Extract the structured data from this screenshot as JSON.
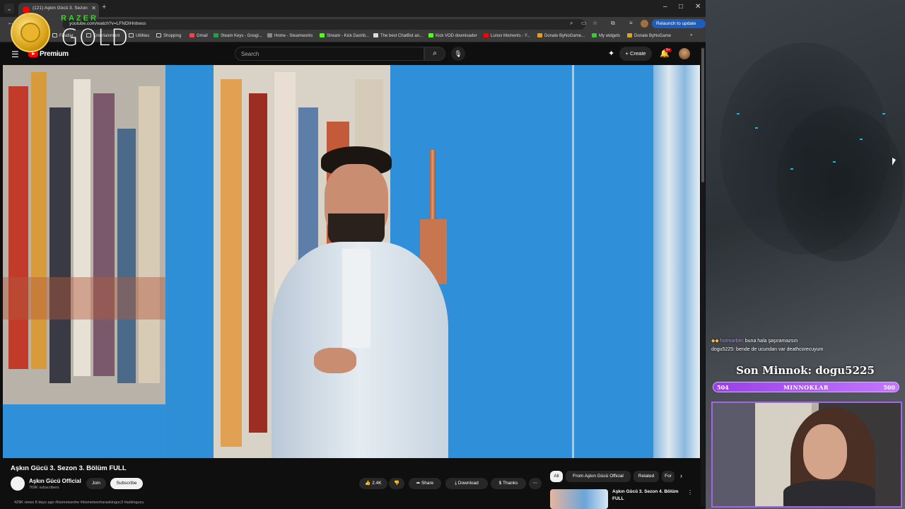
{
  "browser": {
    "tab_title": "(121) Aşkın Gücü 3. Sezon 3. Bö",
    "url": "youtube.com/watch?v=LFNDIHnbwss",
    "relaunch_label": "Relaunch to update",
    "bookmarks": [
      "Fiyatlar",
      "Entertainment",
      "Utilities",
      "Shopping",
      "Gmail",
      "Steam Keys - Googl...",
      "Home - Steamworks",
      "Stream - Kick Dashb...",
      "The best ChatBot an...",
      "Kick VOD downloader",
      "Lunox Moments - Y...",
      "Donate ByNoGame...",
      "My widgets",
      "Donate ByNoGame"
    ]
  },
  "overlay": {
    "brand": "RAZER",
    "tier": "GOLD"
  },
  "youtube": {
    "brand": "Premium",
    "search_placeholder": "Search",
    "create_label": "Create",
    "notif_count": "9+",
    "video": {
      "title": "Aşkın Gücü 3. Sezon 3. Bölüm FULL",
      "channel": "Aşkın Gücü Official",
      "subscribers": "769K subscribers",
      "join_label": "Join",
      "subscribe_label": "Subscribe",
      "likes": "2.4K",
      "share_label": "Share",
      "download_label": "Download",
      "thanks_label": "Thanks",
      "views_line": "429K views  8 days ago  #kismetsenhe #kismetsenharaskinguc3 #askingucu"
    },
    "chips": [
      "All",
      "From Aşkın Gücü Official",
      "Related",
      "For"
    ],
    "recommended": {
      "title": "Aşkın Gücü 3. Sezon 4. Bölüm FULL"
    }
  },
  "stream": {
    "chat": [
      {
        "user": "hotmarble",
        "message": ": buna hala şaşıramazsın"
      },
      {
        "user": "dogu5225",
        "message": ": bende de ucundan var deathcorecuyum"
      }
    ],
    "minnok_title": "Son Minnok: dogu5225",
    "goal_label": "MINNOKLAR",
    "goal_current": "504",
    "goal_target": "500",
    "goal_progress": 1.0
  },
  "colors": {
    "youtube_red": "#ff0000",
    "video_blue": "#2f8fd8",
    "razer_green": "#3dd12c",
    "goal_purple": "#9a3fe6"
  }
}
